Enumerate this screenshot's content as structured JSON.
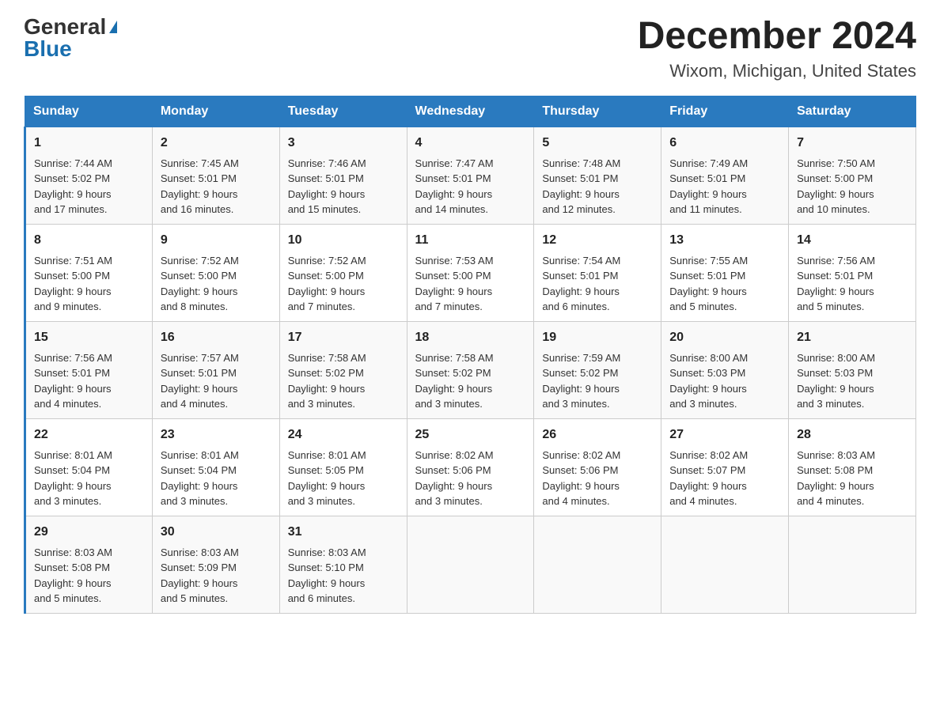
{
  "header": {
    "logo_general": "General",
    "logo_blue": "Blue",
    "month_title": "December 2024",
    "location": "Wixom, Michigan, United States"
  },
  "days_of_week": [
    "Sunday",
    "Monday",
    "Tuesday",
    "Wednesday",
    "Thursday",
    "Friday",
    "Saturday"
  ],
  "weeks": [
    [
      {
        "day": "1",
        "info": "Sunrise: 7:44 AM\nSunset: 5:02 PM\nDaylight: 9 hours\nand 17 minutes."
      },
      {
        "day": "2",
        "info": "Sunrise: 7:45 AM\nSunset: 5:01 PM\nDaylight: 9 hours\nand 16 minutes."
      },
      {
        "day": "3",
        "info": "Sunrise: 7:46 AM\nSunset: 5:01 PM\nDaylight: 9 hours\nand 15 minutes."
      },
      {
        "day": "4",
        "info": "Sunrise: 7:47 AM\nSunset: 5:01 PM\nDaylight: 9 hours\nand 14 minutes."
      },
      {
        "day": "5",
        "info": "Sunrise: 7:48 AM\nSunset: 5:01 PM\nDaylight: 9 hours\nand 12 minutes."
      },
      {
        "day": "6",
        "info": "Sunrise: 7:49 AM\nSunset: 5:01 PM\nDaylight: 9 hours\nand 11 minutes."
      },
      {
        "day": "7",
        "info": "Sunrise: 7:50 AM\nSunset: 5:00 PM\nDaylight: 9 hours\nand 10 minutes."
      }
    ],
    [
      {
        "day": "8",
        "info": "Sunrise: 7:51 AM\nSunset: 5:00 PM\nDaylight: 9 hours\nand 9 minutes."
      },
      {
        "day": "9",
        "info": "Sunrise: 7:52 AM\nSunset: 5:00 PM\nDaylight: 9 hours\nand 8 minutes."
      },
      {
        "day": "10",
        "info": "Sunrise: 7:52 AM\nSunset: 5:00 PM\nDaylight: 9 hours\nand 7 minutes."
      },
      {
        "day": "11",
        "info": "Sunrise: 7:53 AM\nSunset: 5:00 PM\nDaylight: 9 hours\nand 7 minutes."
      },
      {
        "day": "12",
        "info": "Sunrise: 7:54 AM\nSunset: 5:01 PM\nDaylight: 9 hours\nand 6 minutes."
      },
      {
        "day": "13",
        "info": "Sunrise: 7:55 AM\nSunset: 5:01 PM\nDaylight: 9 hours\nand 5 minutes."
      },
      {
        "day": "14",
        "info": "Sunrise: 7:56 AM\nSunset: 5:01 PM\nDaylight: 9 hours\nand 5 minutes."
      }
    ],
    [
      {
        "day": "15",
        "info": "Sunrise: 7:56 AM\nSunset: 5:01 PM\nDaylight: 9 hours\nand 4 minutes."
      },
      {
        "day": "16",
        "info": "Sunrise: 7:57 AM\nSunset: 5:01 PM\nDaylight: 9 hours\nand 4 minutes."
      },
      {
        "day": "17",
        "info": "Sunrise: 7:58 AM\nSunset: 5:02 PM\nDaylight: 9 hours\nand 3 minutes."
      },
      {
        "day": "18",
        "info": "Sunrise: 7:58 AM\nSunset: 5:02 PM\nDaylight: 9 hours\nand 3 minutes."
      },
      {
        "day": "19",
        "info": "Sunrise: 7:59 AM\nSunset: 5:02 PM\nDaylight: 9 hours\nand 3 minutes."
      },
      {
        "day": "20",
        "info": "Sunrise: 8:00 AM\nSunset: 5:03 PM\nDaylight: 9 hours\nand 3 minutes."
      },
      {
        "day": "21",
        "info": "Sunrise: 8:00 AM\nSunset: 5:03 PM\nDaylight: 9 hours\nand 3 minutes."
      }
    ],
    [
      {
        "day": "22",
        "info": "Sunrise: 8:01 AM\nSunset: 5:04 PM\nDaylight: 9 hours\nand 3 minutes."
      },
      {
        "day": "23",
        "info": "Sunrise: 8:01 AM\nSunset: 5:04 PM\nDaylight: 9 hours\nand 3 minutes."
      },
      {
        "day": "24",
        "info": "Sunrise: 8:01 AM\nSunset: 5:05 PM\nDaylight: 9 hours\nand 3 minutes."
      },
      {
        "day": "25",
        "info": "Sunrise: 8:02 AM\nSunset: 5:06 PM\nDaylight: 9 hours\nand 3 minutes."
      },
      {
        "day": "26",
        "info": "Sunrise: 8:02 AM\nSunset: 5:06 PM\nDaylight: 9 hours\nand 4 minutes."
      },
      {
        "day": "27",
        "info": "Sunrise: 8:02 AM\nSunset: 5:07 PM\nDaylight: 9 hours\nand 4 minutes."
      },
      {
        "day": "28",
        "info": "Sunrise: 8:03 AM\nSunset: 5:08 PM\nDaylight: 9 hours\nand 4 minutes."
      }
    ],
    [
      {
        "day": "29",
        "info": "Sunrise: 8:03 AM\nSunset: 5:08 PM\nDaylight: 9 hours\nand 5 minutes."
      },
      {
        "day": "30",
        "info": "Sunrise: 8:03 AM\nSunset: 5:09 PM\nDaylight: 9 hours\nand 5 minutes."
      },
      {
        "day": "31",
        "info": "Sunrise: 8:03 AM\nSunset: 5:10 PM\nDaylight: 9 hours\nand 6 minutes."
      },
      {
        "day": "",
        "info": ""
      },
      {
        "day": "",
        "info": ""
      },
      {
        "day": "",
        "info": ""
      },
      {
        "day": "",
        "info": ""
      }
    ]
  ]
}
